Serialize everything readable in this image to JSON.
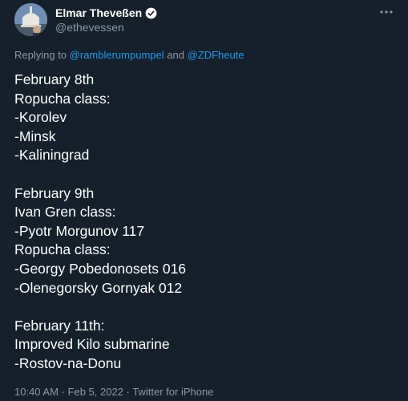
{
  "author": {
    "name": "Elmar Theveßen",
    "handle": "@ethevessen"
  },
  "reply": {
    "prefix": "Replying to",
    "mention1": "@ramblerumpumpel",
    "connector": "and",
    "mention2": "@ZDFheute"
  },
  "tweet": {
    "lines": [
      "February 8th",
      "Ropucha class:",
      "-Korolev",
      "-Minsk",
      "-Kaliningrad",
      "",
      "February 9th",
      "Ivan Gren class:",
      "-Pyotr Morgunov 117",
      "Ropucha class:",
      "-Georgy Pobedonosets 016",
      "-Olenegorsky Gornyak 012",
      "",
      "February 11th:",
      "Improved Kilo submarine",
      "-Rostov-na-Donu"
    ]
  },
  "meta": {
    "time": "10:40 AM",
    "date": "Feb 5, 2022",
    "source": "Twitter for iPhone",
    "separator": "·"
  },
  "icons": {
    "verified": "verified-badge-icon",
    "more": "more-options-icon"
  }
}
